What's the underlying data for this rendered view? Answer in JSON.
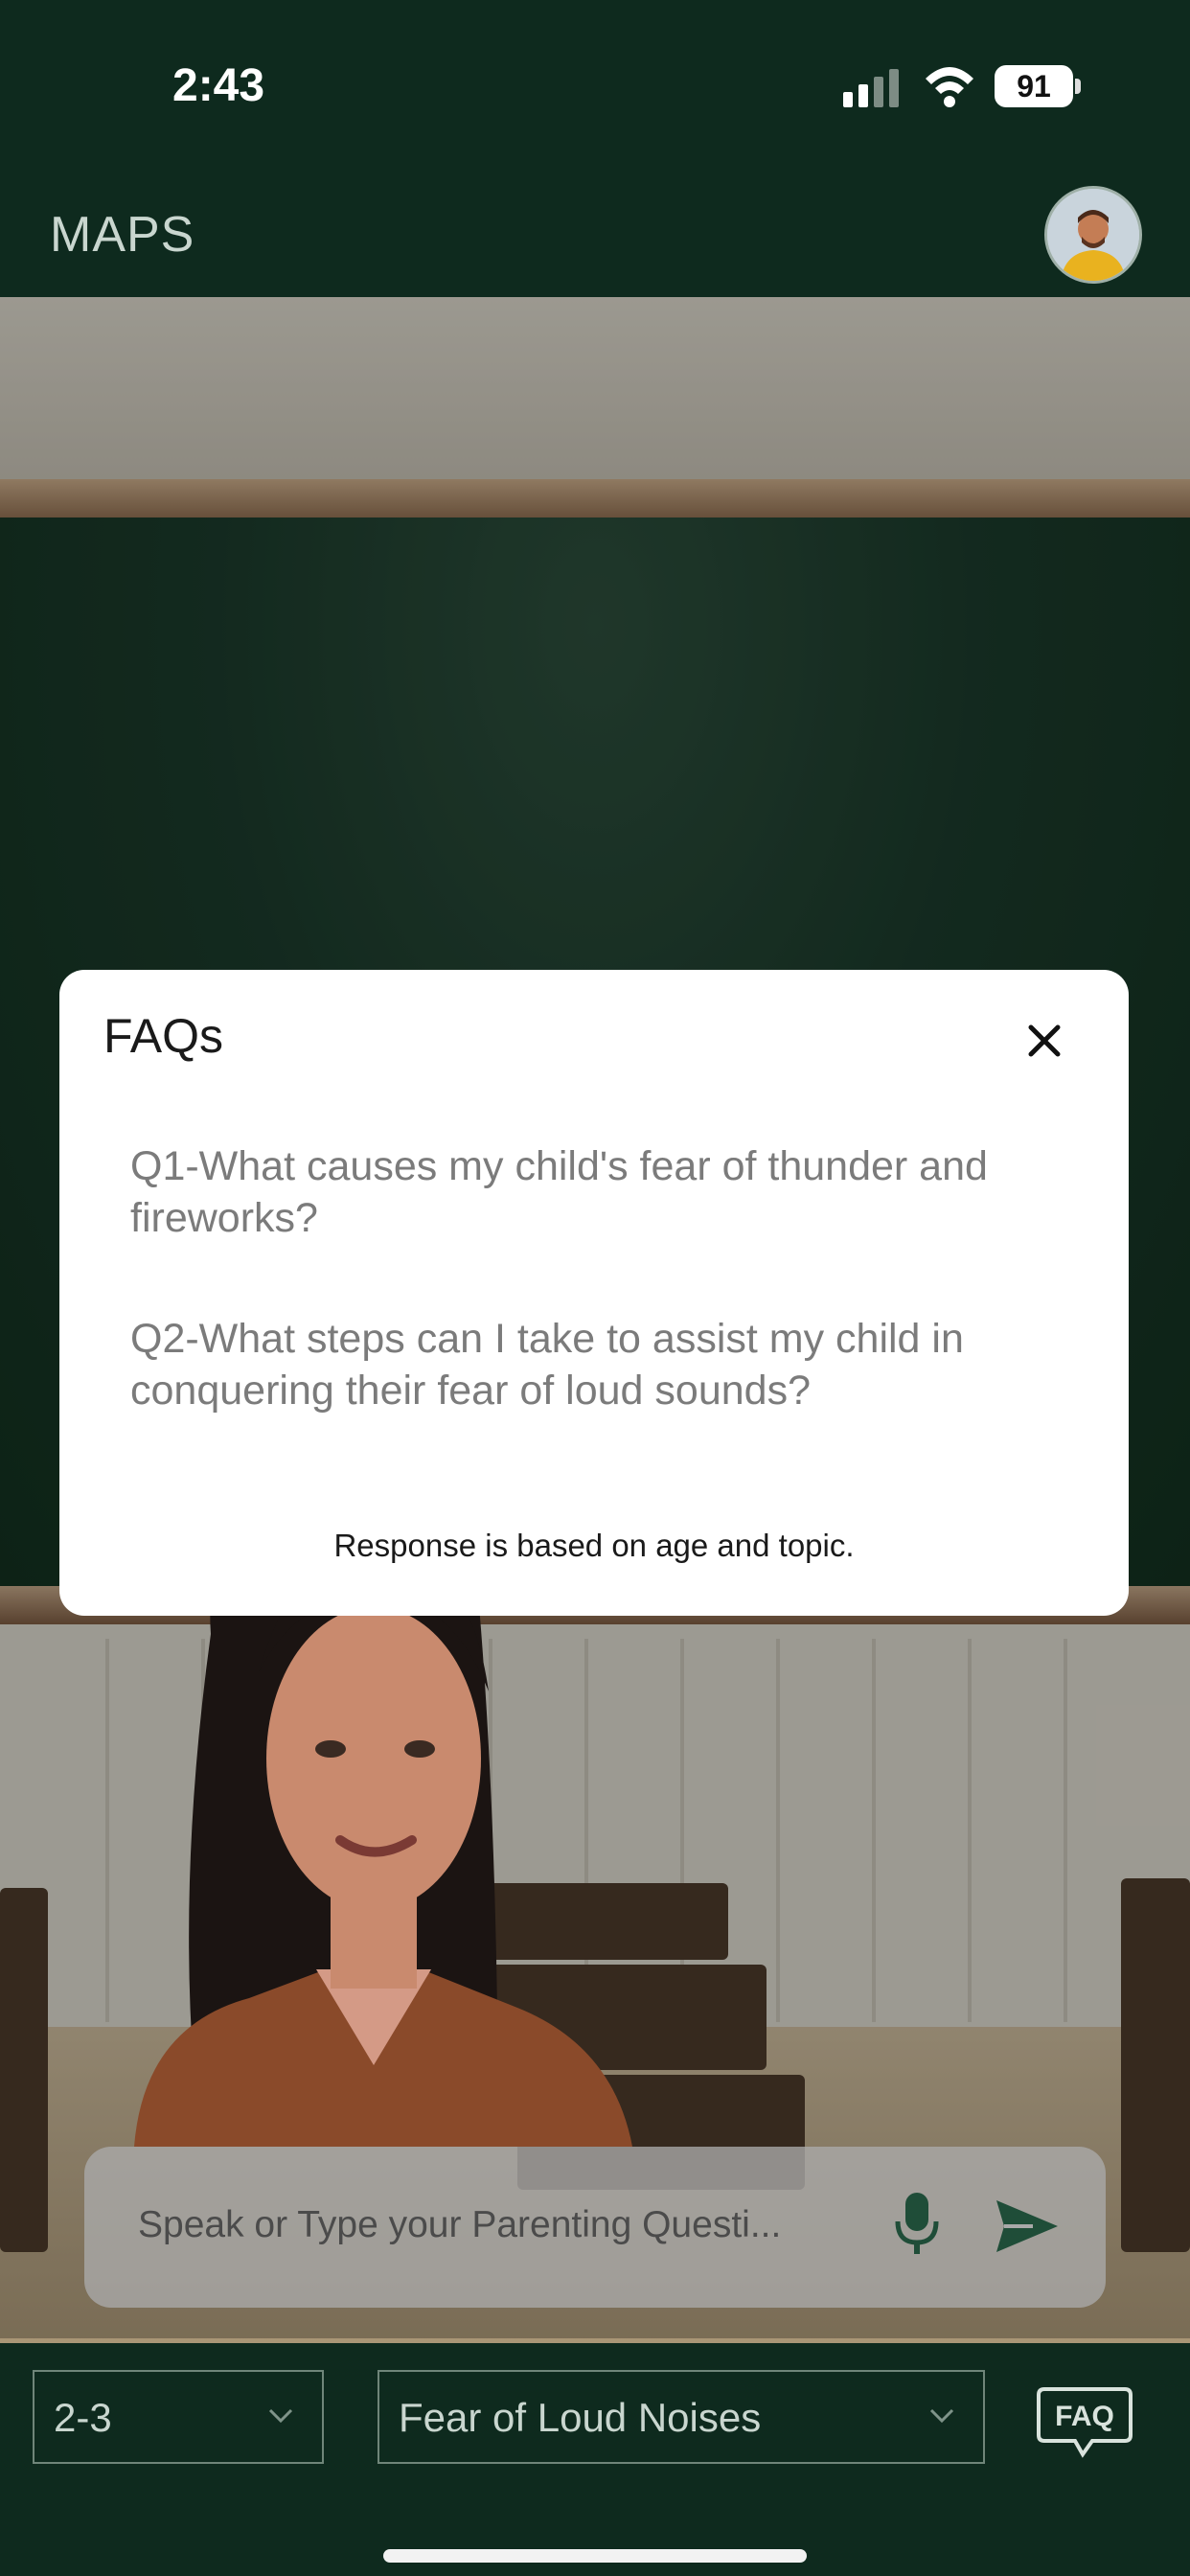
{
  "status_bar": {
    "time": "2:43",
    "battery": "91"
  },
  "header": {
    "app_title": "MAPS",
    "avatar_icon": "user-avatar-icon"
  },
  "faq_modal": {
    "title": "FAQs",
    "questions": [
      "Q1-What causes my child's fear of thunder and fireworks?",
      "Q2-What steps can I take to assist my child in conquering their fear of loud sounds?"
    ],
    "note": "Response is based on age and topic."
  },
  "input": {
    "placeholder": "Speak or Type your Parenting Questi..."
  },
  "filters": {
    "age": {
      "value": "2-3"
    },
    "topic": {
      "value": "Fear of Loud Noises"
    }
  },
  "faq_button": {
    "label": "FAQ"
  },
  "colors": {
    "bar_bg": "#0e2a1e",
    "accent": "#0f3a2a",
    "modal_bg": "#ffffff"
  }
}
